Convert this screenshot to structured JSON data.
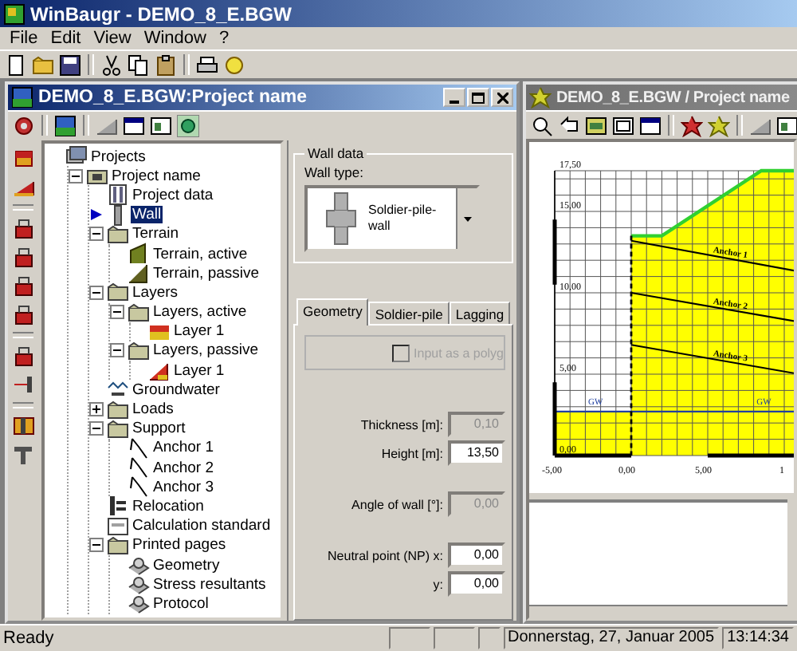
{
  "app": {
    "title": "WinBaugr - DEMO_8_E.BGW"
  },
  "menu": [
    "File",
    "Edit",
    "View",
    "Window",
    "?"
  ],
  "project_window": {
    "title": "DEMO_8_E.BGW:Project name",
    "active": true,
    "tree": [
      {
        "label": "Projects",
        "kind": "projects",
        "selected": false,
        "children": [
          {
            "label": "Project name",
            "kind": "project",
            "selected": false,
            "expanded": true,
            "children": [
              {
                "label": "Project data",
                "kind": "data",
                "selected": false
              },
              {
                "label": "Wall",
                "kind": "wall",
                "selected": true
              },
              {
                "label": "Terrain",
                "kind": "folder",
                "selected": false,
                "expanded": true,
                "children": [
                  {
                    "label": "Terrain, active",
                    "kind": "terrain",
                    "selected": false
                  },
                  {
                    "label": "Terrain, passive",
                    "kind": "slope",
                    "selected": false
                  }
                ]
              },
              {
                "label": "Layers",
                "kind": "folder",
                "selected": false,
                "expanded": true,
                "children": [
                  {
                    "label": "Layers, active",
                    "kind": "folder",
                    "selected": false,
                    "expanded": true,
                    "children": [
                      {
                        "label": "Layer 1",
                        "kind": "layer",
                        "selected": false
                      }
                    ]
                  },
                  {
                    "label": "Layers, passive",
                    "kind": "folder",
                    "selected": false,
                    "expanded": true,
                    "children": [
                      {
                        "label": "Layer 1",
                        "kind": "slope-layer",
                        "selected": false
                      }
                    ]
                  }
                ]
              },
              {
                "label": "Groundwater",
                "kind": "water",
                "selected": false
              },
              {
                "label": "Loads",
                "kind": "folder",
                "selected": false,
                "expanded": false
              },
              {
                "label": "Support",
                "kind": "folder",
                "selected": false,
                "expanded": true,
                "children": [
                  {
                    "label": "Anchor 1",
                    "kind": "anchor",
                    "selected": false
                  },
                  {
                    "label": "Anchor 2",
                    "kind": "anchor",
                    "selected": false
                  },
                  {
                    "label": "Anchor 3",
                    "kind": "anchor",
                    "selected": false
                  }
                ]
              },
              {
                "label": "Relocation",
                "kind": "relocation",
                "selected": false
              },
              {
                "label": "Calculation standard",
                "kind": "standard",
                "selected": false
              },
              {
                "label": "Printed pages",
                "kind": "folder",
                "selected": false,
                "expanded": true,
                "children": [
                  {
                    "label": "Geometry",
                    "kind": "page",
                    "selected": false
                  },
                  {
                    "label": "Stress resultants",
                    "kind": "page",
                    "selected": false
                  },
                  {
                    "label": "Protocol",
                    "kind": "page",
                    "selected": false
                  }
                ]
              }
            ]
          }
        ]
      }
    ],
    "wall_data": {
      "group_title": "Wall data",
      "wall_type_label": "Wall type:",
      "wall_type": "Soldier-pile-\nwall"
    },
    "tabs": [
      {
        "label": "Geometry",
        "selected": true
      },
      {
        "label": "Soldier-pile",
        "selected": false
      },
      {
        "label": "Lagging",
        "selected": false
      }
    ],
    "polygon_input": {
      "label": "Input as a polyg",
      "checked": false,
      "disabled": true
    },
    "fields": [
      {
        "label": "Thickness [m]:",
        "value": "0,10",
        "disabled": true
      },
      {
        "label": "Height [m]:",
        "value": "13,50",
        "disabled": false
      },
      {
        "label": "Angle of wall [°]:",
        "value": "0,00",
        "disabled": true
      },
      {
        "label": "Neutral point (NP) x:",
        "value": "0,00",
        "disabled": false
      },
      {
        "label": "y:",
        "value": "0,00",
        "disabled": false
      }
    ]
  },
  "geometry_window": {
    "title": "DEMO_8_E.BGW / Project name",
    "active": false,
    "y_ticks": [
      "17,50",
      "15,00",
      "10,00",
      "5,00",
      "0,00"
    ],
    "x_ticks": [
      "-5,00",
      "0,00",
      "5,00",
      "1"
    ],
    "anchors": [
      "Anchor 1",
      "Anchor 2",
      "Anchor 3"
    ],
    "groundwater_labels": [
      "GW",
      "GW"
    ]
  },
  "status_bar": {
    "message": "Ready",
    "date": "Donnerstag, 27, Januar 2005",
    "time": "13:14:34"
  }
}
